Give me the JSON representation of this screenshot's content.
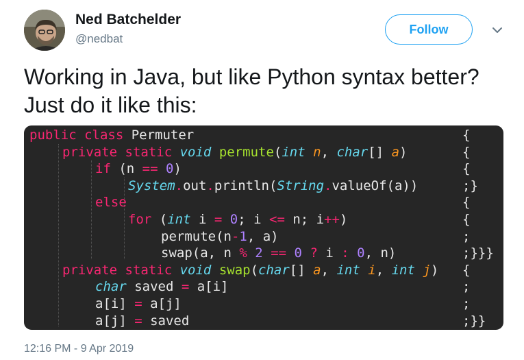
{
  "author": {
    "name": "Ned Batchelder",
    "handle": "@nedbat"
  },
  "follow_label": "Follow",
  "tweet_text": "Working in Java, but like Python syntax better? Just do it like this:",
  "code": {
    "lines": [
      {
        "indent": 0,
        "tail": "{",
        "tokens": [
          {
            "t": "public class ",
            "c": "kw"
          },
          {
            "t": "Permuter",
            "c": "pl"
          }
        ]
      },
      {
        "indent": 1,
        "tail": "{",
        "tokens": [
          {
            "t": "private static ",
            "c": "kw"
          },
          {
            "t": "void",
            "c": "ty"
          },
          {
            "t": " ",
            "c": "pl"
          },
          {
            "t": "permute",
            "c": "fn"
          },
          {
            "t": "(",
            "c": "pl"
          },
          {
            "t": "int",
            "c": "ty"
          },
          {
            "t": " ",
            "c": "pl"
          },
          {
            "t": "n",
            "c": "param"
          },
          {
            "t": ", ",
            "c": "pl"
          },
          {
            "t": "char",
            "c": "ty"
          },
          {
            "t": "[] ",
            "c": "pl"
          },
          {
            "t": "a",
            "c": "param"
          },
          {
            "t": ")",
            "c": "pl"
          }
        ]
      },
      {
        "indent": 2,
        "tail": "{",
        "tokens": [
          {
            "t": "if",
            "c": "kw"
          },
          {
            "t": " (n ",
            "c": "pl"
          },
          {
            "t": "==",
            "c": "kw"
          },
          {
            "t": " ",
            "c": "pl"
          },
          {
            "t": "0",
            "c": "num"
          },
          {
            "t": ")",
            "c": "pl"
          }
        ]
      },
      {
        "indent": 3,
        "tail": ";}",
        "tokens": [
          {
            "t": "System",
            "c": "ty"
          },
          {
            "t": ".",
            "c": "kw"
          },
          {
            "t": "out",
            "c": "pl"
          },
          {
            "t": ".",
            "c": "kw"
          },
          {
            "t": "println(",
            "c": "pl"
          },
          {
            "t": "String",
            "c": "ty"
          },
          {
            "t": ".",
            "c": "kw"
          },
          {
            "t": "valueOf(a))",
            "c": "pl"
          }
        ]
      },
      {
        "indent": 2,
        "tail": "{",
        "tokens": [
          {
            "t": "else",
            "c": "kw"
          }
        ]
      },
      {
        "indent": 3,
        "tail": "{",
        "tokens": [
          {
            "t": "for",
            "c": "kw"
          },
          {
            "t": " (",
            "c": "pl"
          },
          {
            "t": "int",
            "c": "ty"
          },
          {
            "t": " i ",
            "c": "pl"
          },
          {
            "t": "=",
            "c": "kw"
          },
          {
            "t": " ",
            "c": "pl"
          },
          {
            "t": "0",
            "c": "num"
          },
          {
            "t": "; i ",
            "c": "pl"
          },
          {
            "t": "<=",
            "c": "kw"
          },
          {
            "t": " n; i",
            "c": "pl"
          },
          {
            "t": "++",
            "c": "kw"
          },
          {
            "t": ")",
            "c": "pl"
          }
        ]
      },
      {
        "indent": 4,
        "tail": ";",
        "tokens": [
          {
            "t": "permute(n",
            "c": "pl"
          },
          {
            "t": "-",
            "c": "kw"
          },
          {
            "t": "1",
            "c": "num"
          },
          {
            "t": ", a)",
            "c": "pl"
          }
        ]
      },
      {
        "indent": 4,
        "tail": ";}}}",
        "tokens": [
          {
            "t": "swap(a, n ",
            "c": "pl"
          },
          {
            "t": "%",
            "c": "kw"
          },
          {
            "t": " ",
            "c": "pl"
          },
          {
            "t": "2",
            "c": "num"
          },
          {
            "t": " ",
            "c": "pl"
          },
          {
            "t": "==",
            "c": "kw"
          },
          {
            "t": " ",
            "c": "pl"
          },
          {
            "t": "0",
            "c": "num"
          },
          {
            "t": " ",
            "c": "pl"
          },
          {
            "t": "?",
            "c": "kw"
          },
          {
            "t": " i ",
            "c": "pl"
          },
          {
            "t": ":",
            "c": "kw"
          },
          {
            "t": " ",
            "c": "pl"
          },
          {
            "t": "0",
            "c": "num"
          },
          {
            "t": ", n)",
            "c": "pl"
          }
        ]
      },
      {
        "indent": 1,
        "tail": "{",
        "tokens": [
          {
            "t": "private static ",
            "c": "kw"
          },
          {
            "t": "void",
            "c": "ty"
          },
          {
            "t": " ",
            "c": "pl"
          },
          {
            "t": "swap",
            "c": "fn"
          },
          {
            "t": "(",
            "c": "pl"
          },
          {
            "t": "char",
            "c": "ty"
          },
          {
            "t": "[] ",
            "c": "pl"
          },
          {
            "t": "a",
            "c": "param"
          },
          {
            "t": ", ",
            "c": "pl"
          },
          {
            "t": "int",
            "c": "ty"
          },
          {
            "t": " ",
            "c": "pl"
          },
          {
            "t": "i",
            "c": "param"
          },
          {
            "t": ", ",
            "c": "pl"
          },
          {
            "t": "int",
            "c": "ty"
          },
          {
            "t": " ",
            "c": "pl"
          },
          {
            "t": "j",
            "c": "param"
          },
          {
            "t": ")",
            "c": "pl"
          }
        ]
      },
      {
        "indent": 2,
        "tail": ";",
        "tokens": [
          {
            "t": "char",
            "c": "ty"
          },
          {
            "t": " saved ",
            "c": "pl"
          },
          {
            "t": "=",
            "c": "kw"
          },
          {
            "t": " a[i]",
            "c": "pl"
          }
        ]
      },
      {
        "indent": 2,
        "tail": ";",
        "tokens": [
          {
            "t": "a[i] ",
            "c": "pl"
          },
          {
            "t": "=",
            "c": "kw"
          },
          {
            "t": " a[j]",
            "c": "pl"
          }
        ]
      },
      {
        "indent": 2,
        "tail": ";}}",
        "tokens": [
          {
            "t": "a[j] ",
            "c": "pl"
          },
          {
            "t": "=",
            "c": "kw"
          },
          {
            "t": " saved",
            "c": "pl"
          }
        ]
      }
    ]
  },
  "timestamp": "12:16 PM - 9 Apr 2019",
  "colors": {
    "accent": "#1da1f2",
    "code_background": "#262626",
    "keyword": "#f92672",
    "type": "#66d9ef",
    "function": "#a6e22e",
    "number": "#ae81ff",
    "parameter": "#fd971f"
  },
  "icons": {
    "avatar": "user-avatar",
    "caret": "chevron-down-icon"
  }
}
